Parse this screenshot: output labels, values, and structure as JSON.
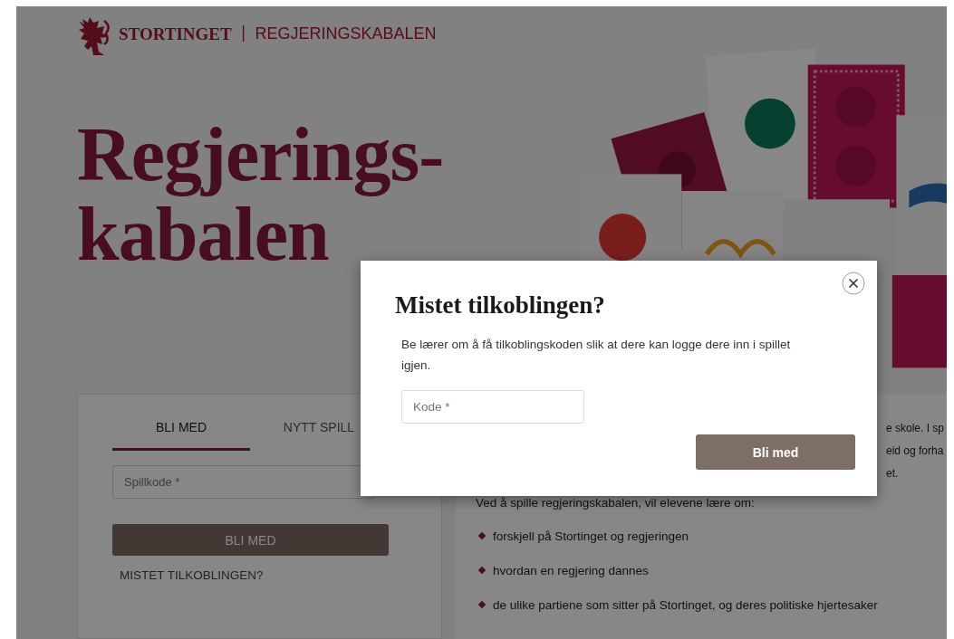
{
  "header": {
    "brand": "STORTINGET",
    "separator": "|",
    "product": "REGJERINGSKABALEN"
  },
  "hero": {
    "title_lines": [
      "Regjerings-",
      "kabalen"
    ]
  },
  "join_panel": {
    "tabs": [
      {
        "label": "BLI MED",
        "selected": true
      },
      {
        "label": "NYTT SPILL",
        "selected": false
      }
    ],
    "field": {
      "placeholder": "Spillkode *"
    },
    "button": "BLI MED",
    "link": "MISTET TILKOBLINGEN?"
  },
  "info_panel": {
    "intro_fragments": [
      "e skole. I sp",
      "eid og forha",
      "et."
    ],
    "lead": "Ved å spille regjeringskabalen, vil elevene lære om:",
    "bullets": [
      "forskjell på Stortinget og regjeringen",
      "hvordan en regjering dannes",
      "de ulike partiene som sitter på Stortinget, og deres politiske hjertesaker"
    ]
  },
  "dialog": {
    "title": "Mistet tilkoblingen?",
    "text": "Be lærer om å få tilkoblingskoden slik at dere kan logge dere inn i spillet igjen.",
    "field": {
      "placeholder": "Kode *"
    },
    "button": "Bli med"
  }
}
